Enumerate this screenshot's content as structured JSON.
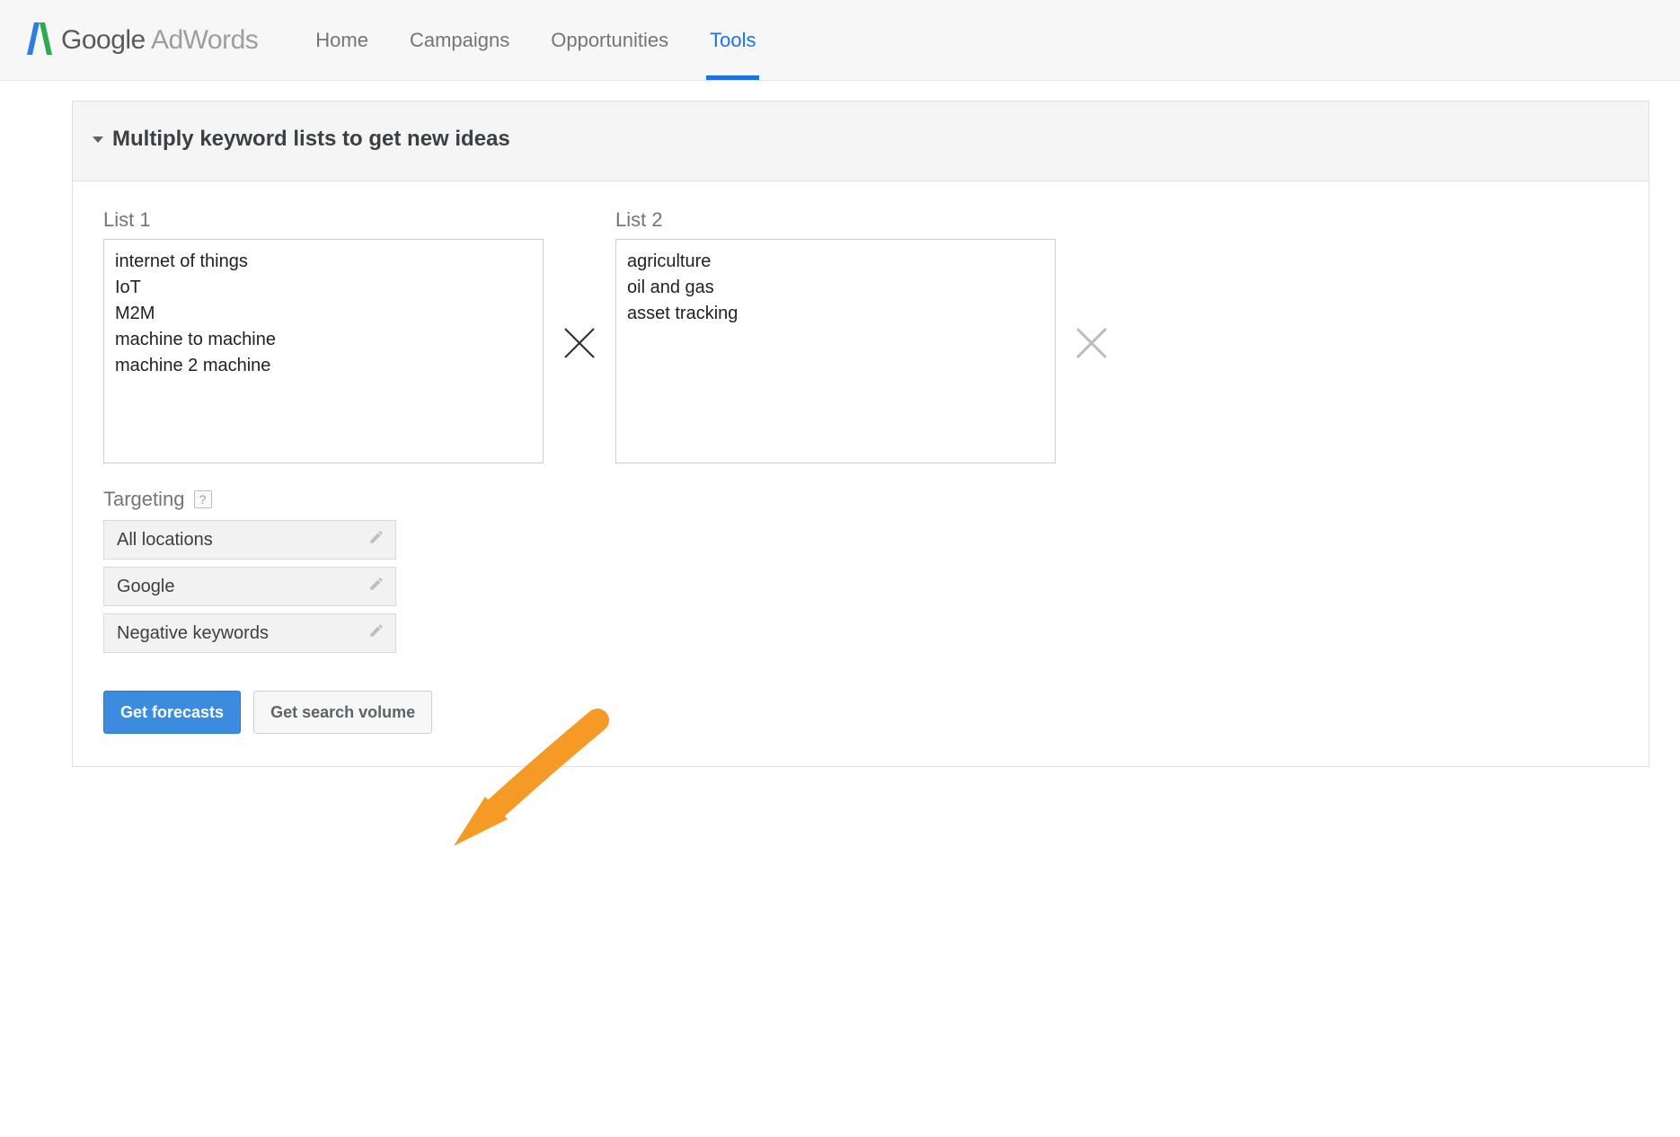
{
  "brand": {
    "name": "Google",
    "product": "AdWords"
  },
  "nav": {
    "items": [
      {
        "label": "Home",
        "active": false
      },
      {
        "label": "Campaigns",
        "active": false
      },
      {
        "label": "Opportunities",
        "active": false
      },
      {
        "label": "Tools",
        "active": true
      }
    ]
  },
  "panel": {
    "title": "Multiply keyword lists to get new ideas"
  },
  "lists": {
    "list1": {
      "label": "List 1",
      "value": "internet of things\nIoT\nM2M\nmachine to machine\nmachine 2 machine"
    },
    "list2": {
      "label": "List 2",
      "value": "agriculture\noil and gas\nasset tracking"
    }
  },
  "targeting": {
    "title": "Targeting",
    "help_symbol": "?",
    "rows": [
      {
        "label": "All locations"
      },
      {
        "label": "Google"
      },
      {
        "label": "Negative keywords"
      }
    ]
  },
  "buttons": {
    "forecasts": "Get forecasts",
    "search_volume": "Get search volume"
  },
  "colors": {
    "accent": "#1a73e8",
    "primary_button": "#3b8cde",
    "annotation_arrow": "#f59b25"
  }
}
